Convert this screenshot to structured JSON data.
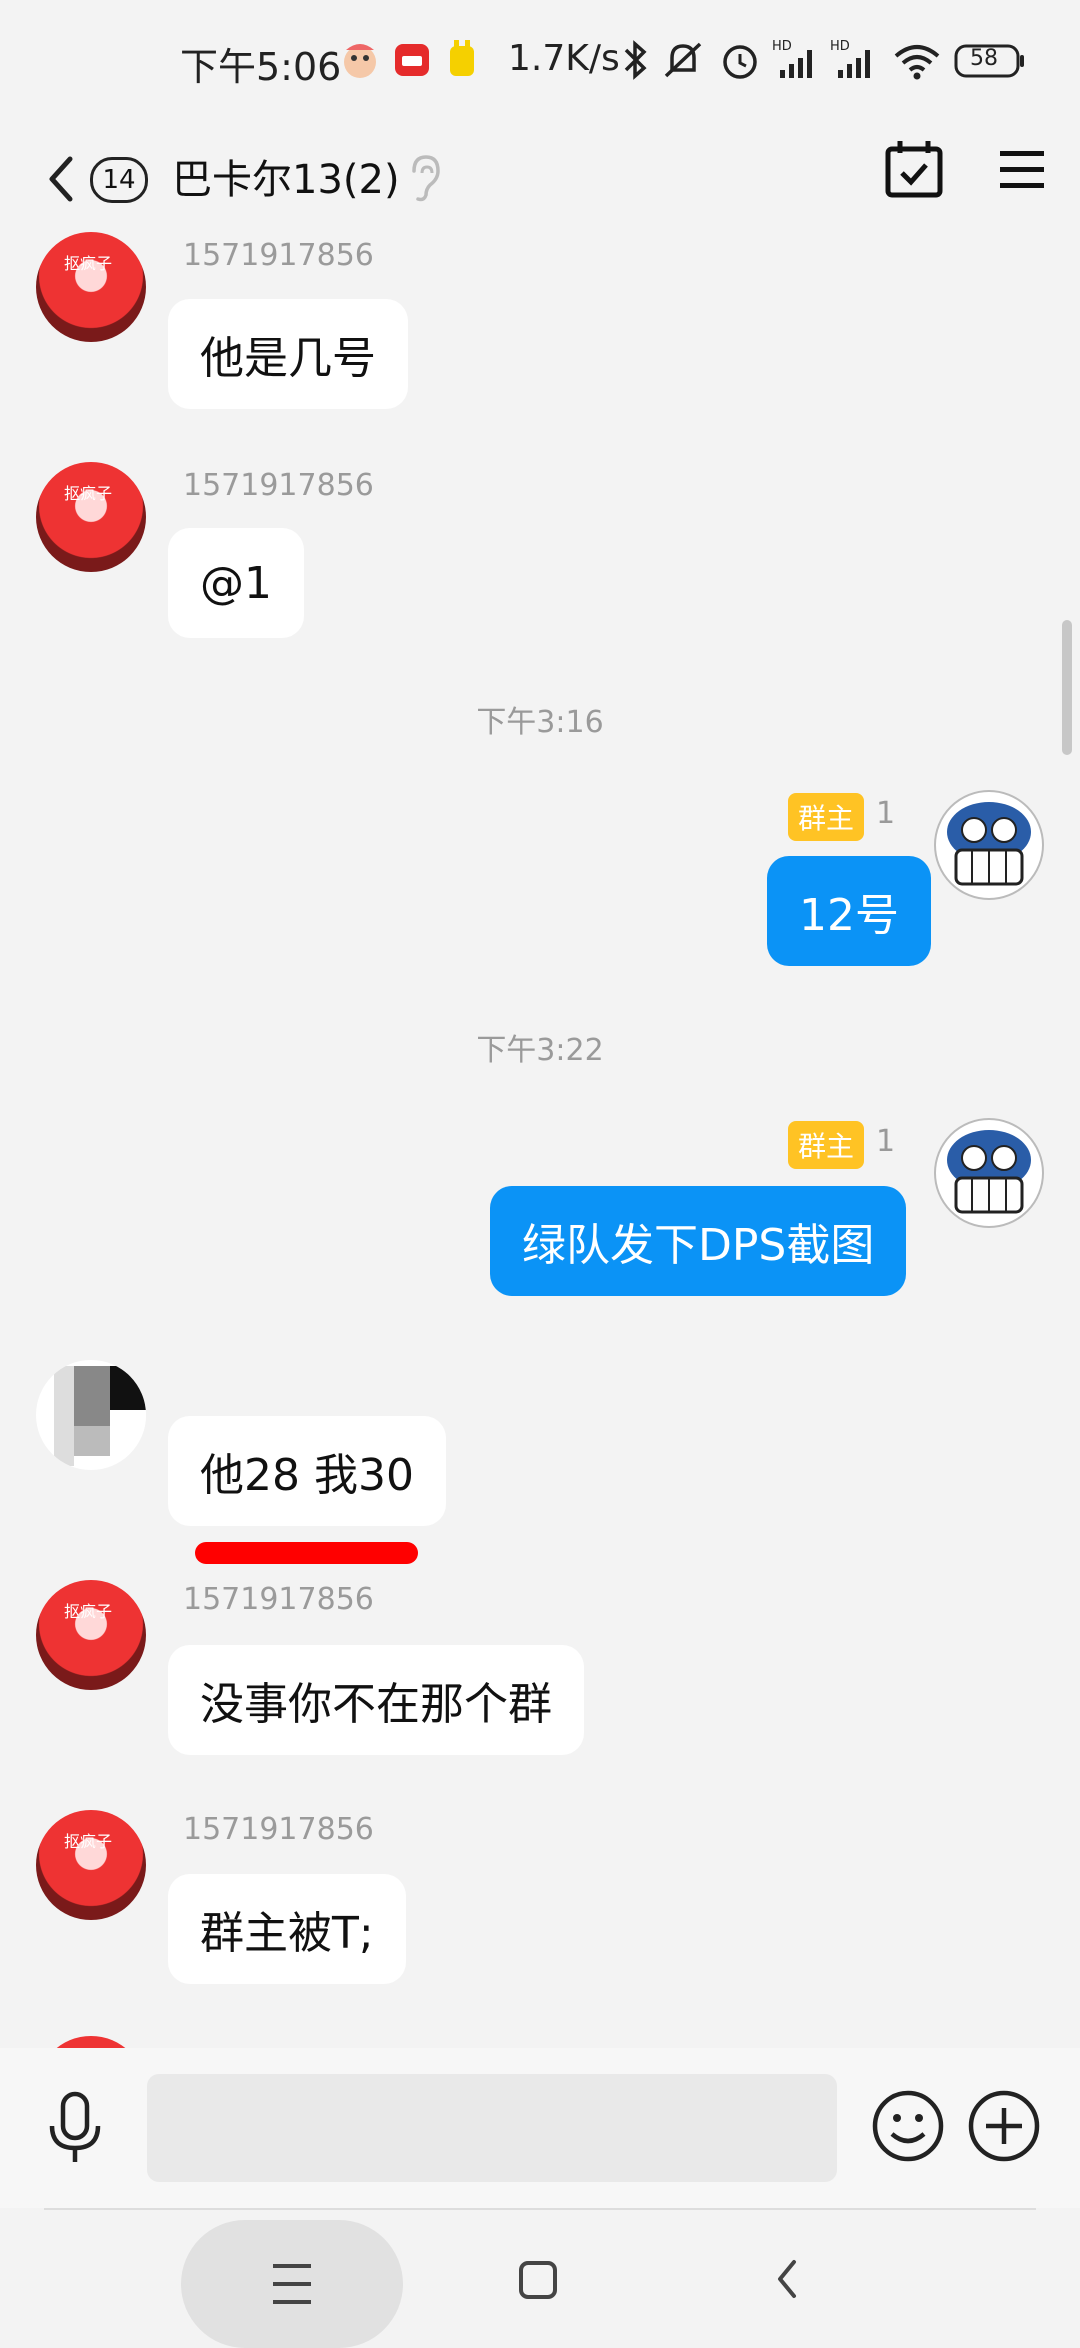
{
  "status_bar": {
    "time": "下午5:06",
    "net_speed": "1.7K/s",
    "battery": "58",
    "icons": [
      "app-icon-1",
      "mail-icon",
      "app-icon-2",
      "bluetooth-icon",
      "mute-icon",
      "alarm-icon",
      "signal-hd-icon",
      "signal-hd-icon",
      "wifi-icon",
      "battery-icon"
    ]
  },
  "header": {
    "unread_count": "14",
    "title": "巴卡尔13(2)",
    "icons": [
      "back-icon",
      "ear-icon",
      "calendar-check-icon",
      "menu-icon"
    ]
  },
  "messages": [
    {
      "sender": "1571917856",
      "text": "他是几号"
    },
    {
      "sender": "1571917856",
      "text": "@1"
    },
    {
      "time": "下午3:16"
    },
    {
      "role": "群主",
      "level": "1",
      "text": "12号"
    },
    {
      "time": "下午3:22"
    },
    {
      "role": "群主",
      "level": "1",
      "text": "绿队发下DPS截图"
    },
    {
      "text": "他28 我30"
    },
    {
      "sender": "1571917856",
      "text": "没事你不在那个群"
    },
    {
      "sender": "1571917856",
      "text": "群主被T;"
    }
  ],
  "avatar_label": "抠疯子",
  "colors": {
    "outgoing_bubble": "#0b93f6",
    "role_tag": "#ffc324",
    "redaction": "#ff0000"
  }
}
